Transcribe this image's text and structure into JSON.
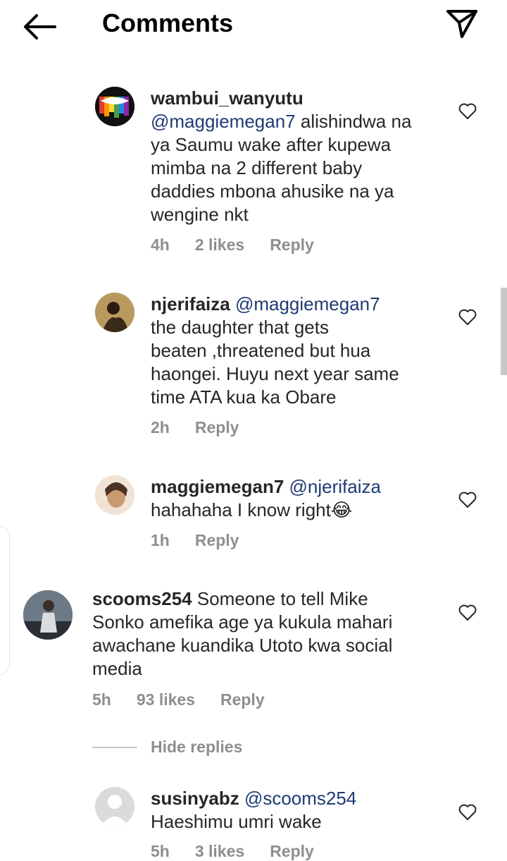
{
  "header": {
    "title": "Comments",
    "back_icon": "back-arrow-icon",
    "send_icon": "paper-plane-icon"
  },
  "comments": [
    {
      "username": "wambui_wanyutu",
      "lines": [
        "@maggiemegan7 alishindwa na",
        "ya Saumu wake after kupewa",
        "mimba na 2 different baby",
        "daddies mbona ahusike na ya",
        "wengine nkt"
      ],
      "mention": "@maggiemegan7",
      "line0_rest": " alishindwa na",
      "time": "4h",
      "likes": "2 likes",
      "reply": "Reply"
    },
    {
      "username": "njerifaiza",
      "mention": "@maggiemegan7",
      "line0_rest": "",
      "lines": [
        "the daughter that gets",
        "beaten ,threatened but hua",
        "haongei. Huyu next year same",
        "time ATA kua ka Obare"
      ],
      "time": "2h",
      "reply": "Reply"
    },
    {
      "username": "maggiemegan7",
      "mention": "@njerifaiza",
      "lines": [
        "hahahaha I know right😂"
      ],
      "time": "1h",
      "reply": "Reply"
    },
    {
      "username": "scooms254",
      "line0_rest": " Someone to tell Mike",
      "lines": [
        "Sonko amefika age ya kukula mahari",
        "awachane kuandika Utoto kwa social",
        "media"
      ],
      "time": "5h",
      "likes": "93 likes",
      "reply": "Reply"
    },
    {
      "username": "susinyabz",
      "mention": "@scooms254",
      "lines": [
        "Haeshimu umri wake"
      ],
      "time": "5h",
      "likes": "3 likes",
      "reply": "Reply"
    }
  ],
  "hide_replies": "Hide replies",
  "colors": {
    "mention": "#1f3b73",
    "meta": "#8e8e8e",
    "text": "#262626"
  }
}
